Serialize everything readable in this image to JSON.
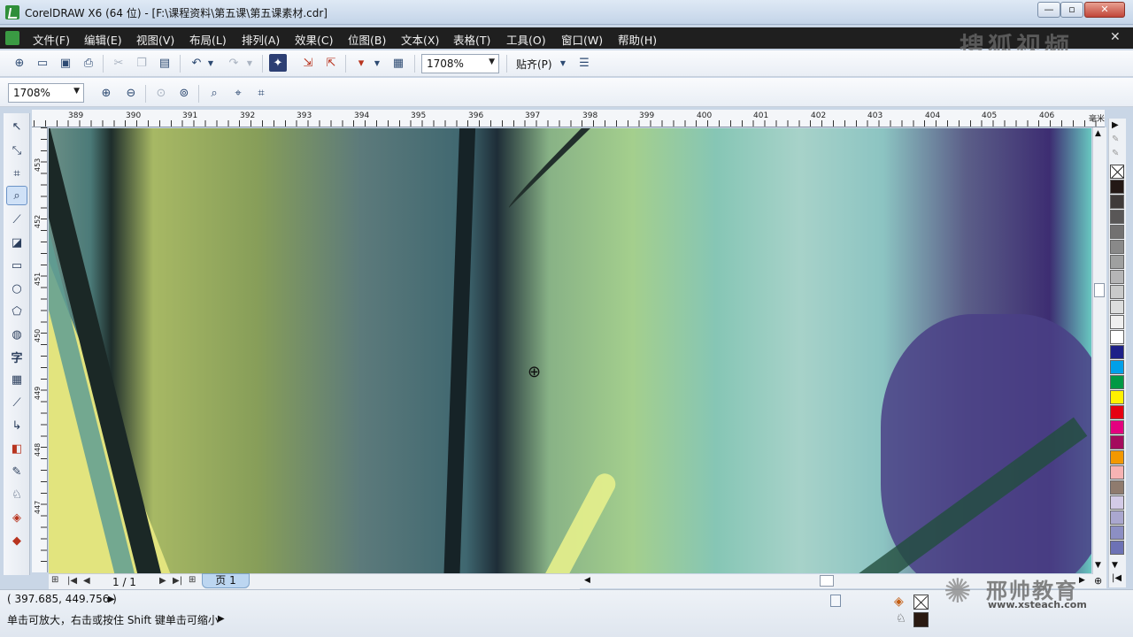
{
  "window": {
    "title": "CorelDRAW X6 (64 位) - [F:\\课程资料\\第五课\\第五课素材.cdr]",
    "min_label": "—",
    "max_label": "▫",
    "close_label": "✕"
  },
  "menu": {
    "items": [
      "文件(F)",
      "编辑(E)",
      "视图(V)",
      "布局(L)",
      "排列(A)",
      "效果(C)",
      "位图(B)",
      "文本(X)",
      "表格(T)",
      "工具(O)",
      "窗口(W)",
      "帮助(H)"
    ],
    "close_glyph": "✕"
  },
  "watermark_top": "搜狐视频",
  "toolbar1": {
    "zoom_value": "1708%",
    "snap_label": "贴齐(P)"
  },
  "toolbar2": {
    "zoom_value": "1708%"
  },
  "ruler": {
    "h_labels": [
      "389",
      "390",
      "391",
      "392",
      "393",
      "394",
      "395",
      "396",
      "397",
      "398",
      "399",
      "400",
      "401",
      "402",
      "403",
      "404",
      "405",
      "406"
    ],
    "unit": "毫米",
    "v_labels": [
      "453",
      "452",
      "451",
      "450",
      "449",
      "448",
      "447"
    ]
  },
  "pagenav": {
    "counter": "1 / 1",
    "tab_label": "页 1"
  },
  "palette": {
    "colors": [
      "#231815",
      "#3e3a39",
      "#595757",
      "#727171",
      "#898989",
      "#9fa0a0",
      "#b5b5b6",
      "#c9caca",
      "#dcdddd",
      "#efefef",
      "#ffffff",
      "#1d2088",
      "#00a0e9",
      "#009944",
      "#fff100",
      "#e60012",
      "#e4007f",
      "#a40b5d",
      "#f39800",
      "#f6b3b3",
      "#8f7b6e",
      "#d3cbe7",
      "#aaa7cf",
      "#8c8fc4",
      "#6d72b5"
    ]
  },
  "status": {
    "cursor_position": "( 397.685, 449.756 )",
    "hint": "单击可放大，右击或按住 Shift 键单击可缩小"
  },
  "watermark_bottom": {
    "name": "邢帅教育",
    "url": "www.xsteach.com"
  }
}
